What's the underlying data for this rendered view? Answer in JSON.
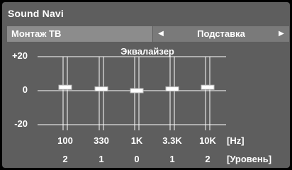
{
  "window": {
    "title": "Sound Navi"
  },
  "setting_row": {
    "label": "Монтаж ТВ",
    "value": "Подставка",
    "left_arrow_icon": "triangle-left-icon",
    "right_arrow_icon": "triangle-right-icon"
  },
  "equalizer": {
    "title": "Эквалайзер",
    "freq_unit": "[Hz]",
    "level_unit": "[Уровень]"
  },
  "chart_data": {
    "type": "bar",
    "categories": [
      "100",
      "330",
      "1K",
      "3.3K",
      "10K"
    ],
    "values": [
      2,
      1,
      0,
      1,
      2
    ],
    "ylim": [
      -20,
      20
    ],
    "yticks": [
      "+20",
      "0",
      "-20"
    ],
    "ytick_values": [
      20,
      0,
      -20
    ]
  },
  "colors": {
    "background": "#000000",
    "panel": "#5e5e5e",
    "row_label_bg": "#8c8c8c",
    "row_value_bg": "#7a7a7a",
    "line": "#ffffff",
    "handle": "#ffffff"
  }
}
